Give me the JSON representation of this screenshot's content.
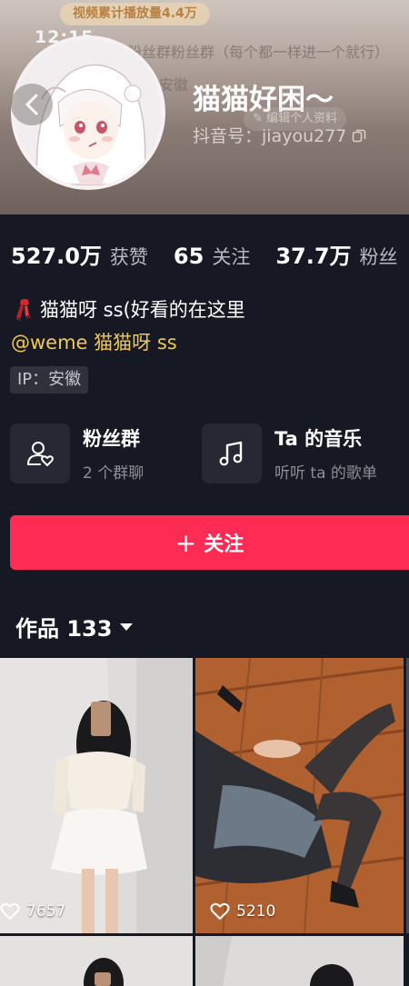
{
  "header": {
    "promo": "视频累计播放量4.4万",
    "status_time": "12:15",
    "ghost_line1": "粉丝群粉丝群（每个都一样进一个就行）",
    "ghost_line2": "安徽",
    "nickname": "猫猫好困～",
    "edit_hint": "编辑个人资料",
    "douyin_id": "抖音号：jiayou277"
  },
  "stats": [
    {
      "value": "527.0万",
      "label": "获赞"
    },
    {
      "value": "65",
      "label": "关注"
    },
    {
      "value": "37.7万",
      "label": "粉丝"
    }
  ],
  "bio": {
    "line1": "猫猫呀 ss(好看的在这里",
    "line2": "@weme 猫猫呀 ss",
    "ip": "IP：安徽"
  },
  "features": [
    {
      "title": "粉丝群",
      "subtitle": "2 个群聊",
      "icon": "fan-group-icon"
    },
    {
      "title": "Ta 的音乐",
      "subtitle": "听听 ta 的歌单",
      "icon": "music-note-icon"
    }
  ],
  "follow": {
    "label": "关注"
  },
  "works": {
    "label": "作品 133"
  },
  "videos": [
    {
      "likes": "7657"
    },
    {
      "likes": "5210"
    }
  ],
  "colors": {
    "background": "#161823",
    "accent": "#fe2c55",
    "mention": "#f3c84f"
  }
}
